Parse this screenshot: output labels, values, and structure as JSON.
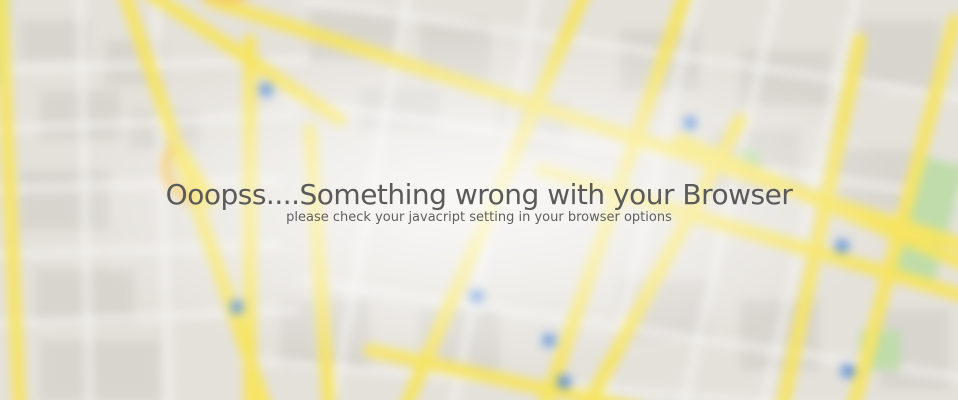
{
  "error_message": {
    "headline": "Ooopss....Something wrong with your Browser",
    "subtext": "please check your javacript setting in your browser options"
  },
  "background": {
    "icon": "blurred-street-map",
    "colors": {
      "land": "#e6e3de",
      "block": "#d9d6d0",
      "major_road": "#f6e663",
      "minor_road": "#f5f4f2",
      "park": "#b9d9a6",
      "transit_marker": "#5b8fd6"
    }
  }
}
